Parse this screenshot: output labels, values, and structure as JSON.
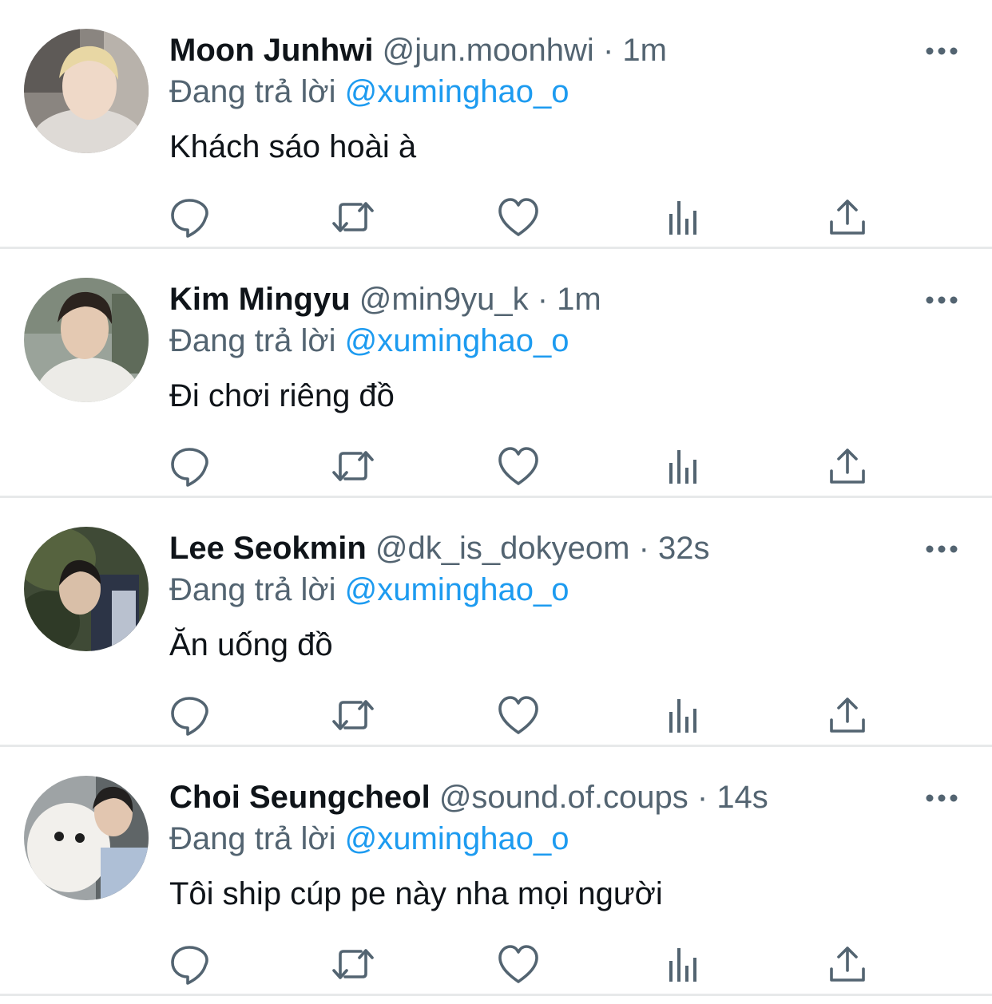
{
  "colors": {
    "text_primary": "#0f1419",
    "text_secondary": "#536471",
    "mention": "#1d9bf0",
    "divider": "#e7e9ea",
    "icon": "#536471"
  },
  "icons": {
    "reply": "reply-icon",
    "retweet": "retweet-icon",
    "like": "heart-icon",
    "views": "analytics-icon",
    "share": "share-icon",
    "more": "more-icon"
  },
  "separator": "·",
  "replies": [
    {
      "display_name": "Moon Junhwi",
      "handle": "@jun.moonhwi",
      "time": "1m",
      "replying_prefix": "Đang trả lời",
      "replying_to": "@xuminghao_o",
      "text": "Khách sáo hoài à"
    },
    {
      "display_name": "Kim Mingyu",
      "handle": "@min9yu_k",
      "time": "1m",
      "replying_prefix": "Đang trả lời",
      "replying_to": "@xuminghao_o",
      "text": "Đi chơi riêng đồ"
    },
    {
      "display_name": "Lee Seokmin",
      "handle": "@dk_is_dokyeom",
      "time": "32s",
      "replying_prefix": "Đang trả lời",
      "replying_to": "@xuminghao_o",
      "text": "Ăn uống đồ"
    },
    {
      "display_name": "Choi Seungcheol",
      "handle": "@sound.of.coups",
      "time": "14s",
      "replying_prefix": "Đang trả lời",
      "replying_to": "@xuminghao_o",
      "text": "Tôi ship cúp pe này nha mọi người"
    }
  ]
}
